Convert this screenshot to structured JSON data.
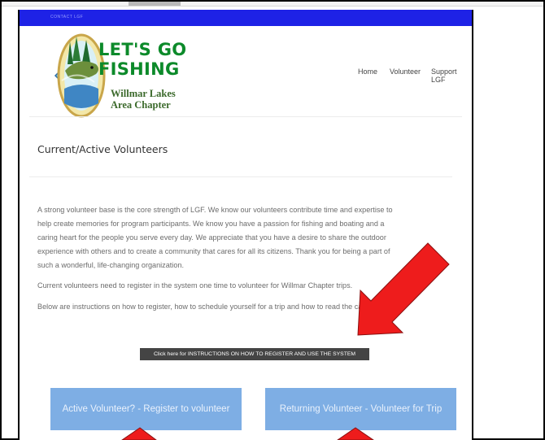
{
  "header": {
    "bar_text": "CONTACT LGF"
  },
  "logo": {
    "title_line1": "LET'S GO",
    "title_line2": "FISHING",
    "subtitle_line1": "Willmar Lakes",
    "subtitle_line2": "Area Chapter"
  },
  "nav": {
    "items": [
      {
        "label": "Home"
      },
      {
        "label": "Volunteer"
      },
      {
        "label": "Support LGF"
      }
    ]
  },
  "main": {
    "title": "Current/Active Volunteers",
    "paragraph1_lines": [
      "A strong volunteer base is the core strength of LGF. We know our volunteers contribute time and expertise to",
      "help create memories for program participants. We know you have a passion for fishing and boating and a",
      "caring heart for the people you serve every day. We appreciate that you have a desire to share the outdoor",
      "experience with others and to create a community that cares for all its citizens. Thank you for being a part of",
      "such a wonderful, life-changing organization."
    ],
    "paragraph2": "Current volunteers need to register in the system one time to volunteer for Willmar Chapter trips.",
    "paragraph3": "Below are instructions on how to register, how to schedule yourself for a trip and how to read the calendar.",
    "instructions_button": "Click here for INSTRUCTIONS ON HOW TO REGISTER AND USE THE SYSTEM",
    "register_button": "Active Volunteer? - Register to volunteer",
    "returning_button": "Returning Volunteer - Volunteer for Trip"
  },
  "colors": {
    "top_bar": "#1e22e6",
    "logo_green": "#0c8a2a",
    "button_blue": "#7eaee4",
    "instructions_dark": "#444444",
    "arrow_red": "#ee1c1c"
  },
  "icons": [
    "annotation-arrow-icon",
    "fish-logo-icon"
  ]
}
